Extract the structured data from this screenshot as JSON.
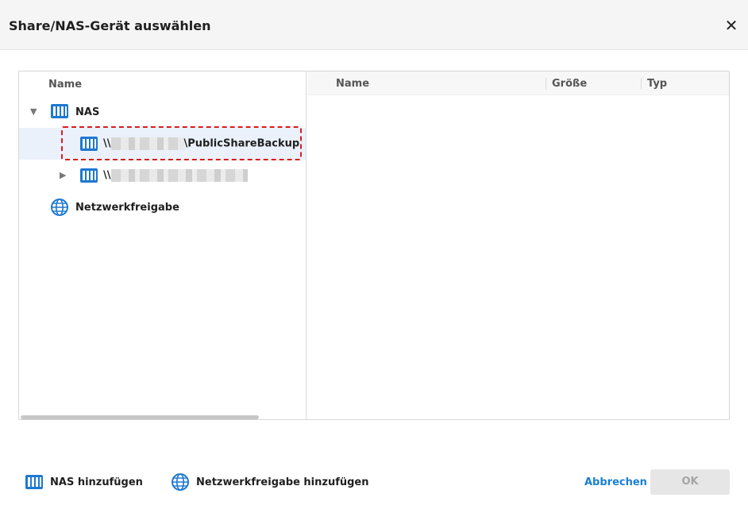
{
  "dialog": {
    "title": "Share/NAS-Gerät auswählen",
    "close_glyph": "✕"
  },
  "tree": {
    "header": "Name",
    "items": [
      {
        "label": "NAS",
        "icon": "nas-icon",
        "expanded": true
      },
      {
        "label_prefix": "\\\\",
        "label_suffix": "\\PublicShareBackup",
        "icon": "nas-icon",
        "selected": true
      },
      {
        "label_prefix": "\\\\",
        "icon": "nas-icon",
        "expanded": false
      },
      {
        "label": "Netzwerkfreigabe",
        "icon": "globe-icon"
      }
    ]
  },
  "list": {
    "columns": [
      "Name",
      "Größe",
      "Typ"
    ]
  },
  "footer": {
    "add_nas": "NAS hinzufügen",
    "add_share": "Netzwerkfreigabe hinzufügen",
    "cancel": "Abbrechen",
    "ok": "OK"
  },
  "colors": {
    "accent": "#1a7fd4",
    "selection": "#eaf1fb",
    "highlight_border": "#d81e1e",
    "icon_blue": "#1e78d2"
  }
}
